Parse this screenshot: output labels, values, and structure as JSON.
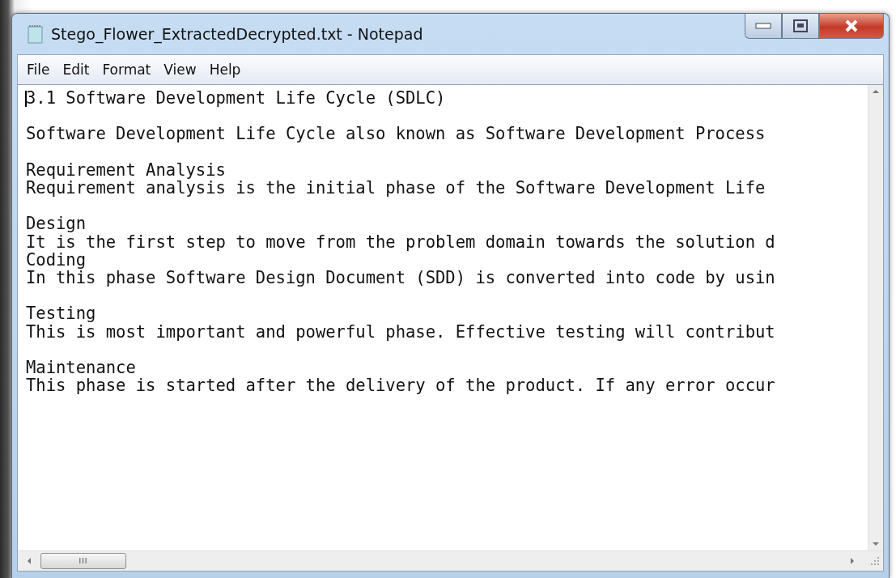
{
  "window": {
    "title": "Stego_Flower_ExtractedDecrypted.txt - Notepad"
  },
  "menu": [
    "File",
    "Edit",
    "Format",
    "View",
    "Help"
  ],
  "document": {
    "caret": true,
    "paragraphs": [
      [
        "3.1 Software Development Life Cycle (SDLC)"
      ],
      [
        "Software Development Life Cycle also known as Software Development Process"
      ],
      [
        "Requirement Analysis",
        "Requirement analysis is the initial phase of the Software Development Life"
      ],
      [
        "Design",
        "It is the first step to move from the problem domain towards the solution d",
        "Coding",
        "In this phase Software Design Document (SDD) is converted into code by usin"
      ],
      [
        "Testing",
        "This is most important and powerful phase. Effective testing will contribut"
      ],
      [
        "Maintenance",
        "This phase is started after the delivery of the product. If any error occur"
      ]
    ]
  },
  "scrollbar_grip": "III"
}
